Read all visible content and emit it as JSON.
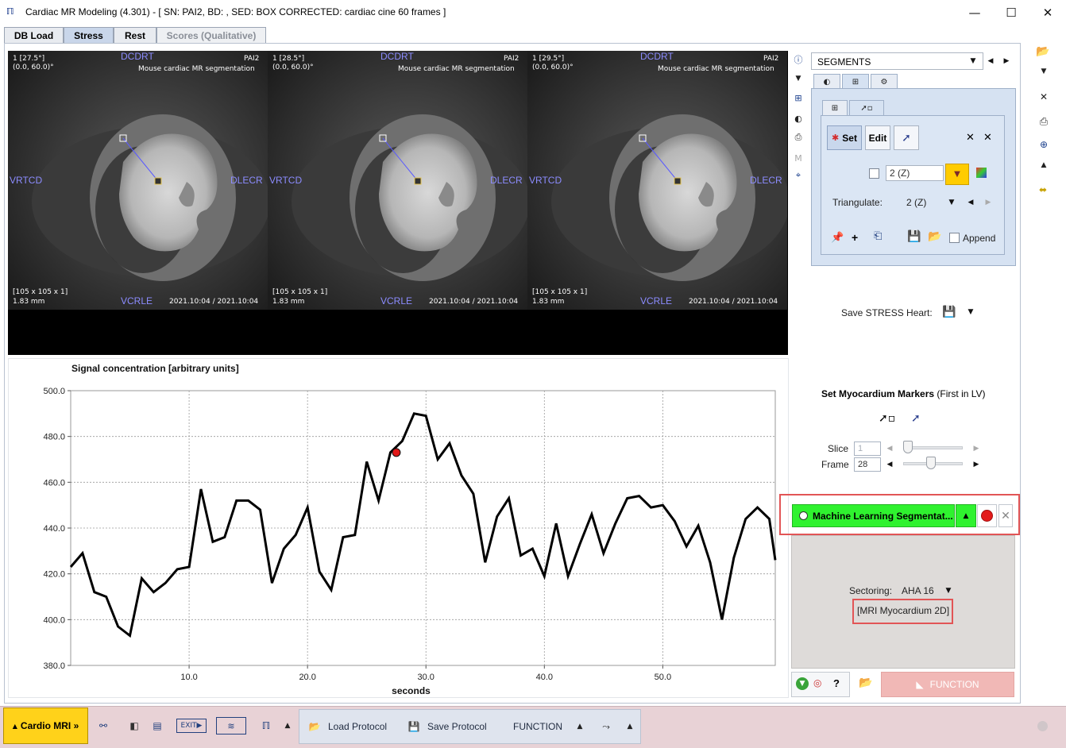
{
  "window": {
    "icon": "pmod-logo-icon",
    "title": "Cardiac MR Modeling (4.301) - [ SN: PAI2, BD: , SED: BOX CORRECTED: cardiac cine 60 frames ]",
    "controls": [
      "minimize-icon",
      "maximize-icon",
      "close-icon"
    ]
  },
  "tabs": [
    {
      "label": "DB Load",
      "state": "normal"
    },
    {
      "label": "Stress",
      "state": "active"
    },
    {
      "label": "Rest",
      "state": "normal"
    },
    {
      "label": "Scores (Qualitative)",
      "state": "disabled"
    }
  ],
  "views": [
    {
      "slice_angle": "1 [27.5°]",
      "coords": "(0.0, 60.0)°",
      "top": "DCDRT",
      "left": "VRTCD",
      "right": "DLECR",
      "bottom": "VCRLE",
      "study": "PAI2",
      "desc": "Mouse cardiac MR segmentation",
      "matrix": "[105 x 105 x 1]",
      "voxel": "1.83 mm",
      "date": "2021.10:04 / 2021.10:04"
    },
    {
      "slice_angle": "1 [28.5°]",
      "coords": "(0.0, 60.0)°",
      "top": "DCDRT",
      "left": "VRTCD",
      "right": "DLECR",
      "bottom": "VCRLE",
      "study": "PAI2",
      "desc": "Mouse cardiac MR segmentation",
      "matrix": "[105 x 105 x 1]",
      "voxel": "1.83 mm",
      "date": "2021.10:04 / 2021.10:04"
    },
    {
      "slice_angle": "1 [29.5°]",
      "coords": "(0.0, 60.0)°",
      "top": "DCDRT",
      "left": "VRTCD",
      "right": "DLECR",
      "bottom": "VCRLE",
      "study": "PAI2",
      "desc": "Mouse cardiac MR segmentation",
      "matrix": "[105 x 105 x 1]",
      "voxel": "1.83 mm",
      "date": "2021.10:04 / 2021.10:04"
    }
  ],
  "chart_data": {
    "type": "line",
    "title": "Signal concentration [arbitrary units]",
    "xlabel": "seconds",
    "ylabel": "",
    "xlim": [
      0,
      59.5
    ],
    "ylim": [
      380,
      500
    ],
    "x_ticks": [
      10,
      20,
      30,
      40,
      50
    ],
    "x_tick_labels": [
      "10.0",
      "20.0",
      "30.0",
      "40.0",
      "50.0"
    ],
    "y_ticks": [
      380,
      400,
      420,
      440,
      460,
      480,
      500
    ],
    "y_tick_labels": [
      "380.0",
      "400.0",
      "420.0",
      "440.0",
      "460.0",
      "480.0",
      "500.0"
    ],
    "grid": true,
    "series": [
      {
        "color": "#000000",
        "x": [
          0,
          1,
          2,
          3,
          4,
          5,
          6,
          7,
          8,
          9,
          10,
          11,
          12,
          13,
          14,
          15,
          16,
          17,
          18,
          19,
          20,
          21,
          22,
          23,
          24,
          25,
          26,
          27,
          28,
          29,
          30,
          31,
          32,
          33,
          34,
          35,
          36,
          37,
          38,
          39,
          40,
          41,
          42,
          43,
          44,
          45,
          46,
          47,
          48,
          49,
          50,
          51,
          52,
          53,
          54,
          55,
          56,
          57,
          58,
          59,
          59.5
        ],
        "y": [
          423,
          429,
          412,
          410,
          397,
          393,
          418,
          412,
          416,
          422,
          423,
          457,
          434,
          436,
          452,
          452,
          448,
          416,
          431,
          437,
          449,
          421,
          413,
          436,
          437,
          469,
          452,
          473,
          478,
          490,
          489,
          470,
          477,
          463,
          455,
          425,
          445,
          453,
          428,
          431,
          419,
          442,
          419,
          433,
          446,
          429,
          442,
          453,
          454,
          449,
          450,
          443,
          432,
          441,
          425,
          400,
          427,
          444,
          449,
          444,
          426
        ]
      }
    ],
    "marker": {
      "x": 27.5,
      "y": 473,
      "color": "#e11818"
    }
  },
  "right_icons": [
    "info-icon",
    "caret-down-icon",
    "layout-icon",
    "contrast-icon",
    "print-icon",
    "m-icon",
    "crosshair-icon"
  ],
  "segments": {
    "selected": "SEGMENTS",
    "tabs": [
      "contrast-icon",
      "grid-icon",
      "tools-icon"
    ],
    "inner_tabs": [
      "grid-icon",
      "pointer-icon"
    ],
    "set_label": "Set",
    "edit_label": "Edit",
    "z_value": "2 (Z)",
    "triangulate_label": "Triangulate:",
    "triangulate_value": "2 (Z)",
    "append_label": "Append",
    "plus_label": "+"
  },
  "save_heart_label": "Save STRESS Heart:",
  "myocardium": {
    "title": "Set Myocardium Markers",
    "subtitle": "(First in LV)",
    "slice_label": "Slice",
    "slice_value": "1",
    "frame_label": "Frame",
    "frame_value": "28",
    "slice_position": 0,
    "frame_position": 0.46
  },
  "ml_button_label": "Machine Learning Segmentat...",
  "sectoring_label": "Sectoring:",
  "sectoring_value": "AHA 16",
  "myocardium_model": "[MRI Myocardium 2D]",
  "help_label": "?",
  "function_label": "FUNCTION",
  "bottom": {
    "cardio_label": "Cardio MRI »",
    "load_protocol": "Load Protocol",
    "save_protocol": "Save Protocol",
    "function": "FUNCTION"
  },
  "side_toolbar": [
    "open-folder-icon",
    "caret-down-icon",
    "close-x-icon",
    "save-stack-icon",
    "zoom-icon",
    "caret-up-icon",
    "tag-icon"
  ]
}
